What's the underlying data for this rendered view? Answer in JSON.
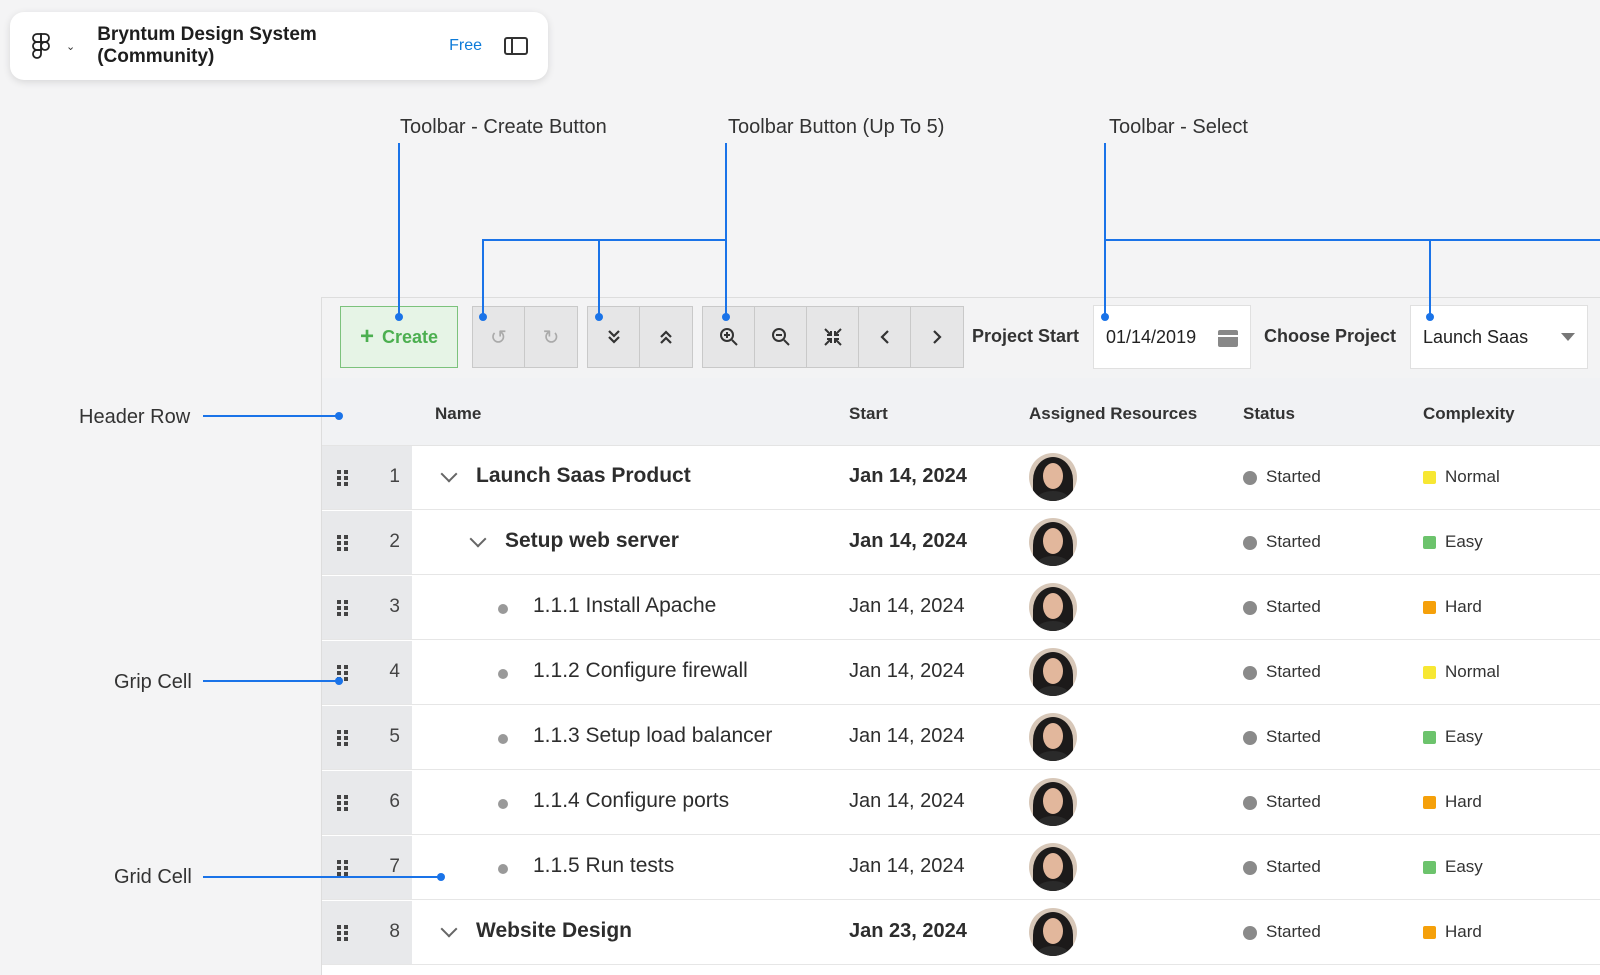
{
  "figma": {
    "title": "Bryntum Design System (Community)",
    "badge": "Free"
  },
  "annotations": {
    "create_button": "Toolbar - Create Button",
    "toolbar_button": "Toolbar Button (Up To 5)",
    "toolbar_select": "Toolbar - Select",
    "header_row": "Header Row",
    "grip_cell": "Grip Cell",
    "grid_cell": "Grid Cell"
  },
  "toolbar": {
    "create_label": "Create",
    "project_start_label": "Project Start",
    "project_start_value": "01/14/2019",
    "choose_project_label": "Choose Project",
    "choose_project_value": "Launch Saas",
    "buttons": [
      {
        "icon": "undo-icon",
        "glyph": "↺"
      },
      {
        "icon": "redo-icon",
        "glyph": "↻"
      },
      {
        "icon": "expand-all-icon",
        "glyph": "⌄"
      },
      {
        "icon": "collapse-all-icon",
        "glyph": "⌃"
      },
      {
        "icon": "zoom-in-icon",
        "glyph": "⊕"
      },
      {
        "icon": "zoom-out-icon",
        "glyph": "⊖"
      },
      {
        "icon": "zoom-to-fit-icon",
        "glyph": "⤧"
      },
      {
        "icon": "previous-icon",
        "glyph": "‹"
      },
      {
        "icon": "next-icon",
        "glyph": "›"
      }
    ]
  },
  "columns": [
    "Name",
    "Start",
    "Assigned Resources",
    "Status",
    "Complexity"
  ],
  "colors": {
    "accent": "#1a73e8",
    "create_green": "#4caf50",
    "normal": "#f7e733",
    "easy": "#6cc36c",
    "hard": "#f5a00a",
    "status": "#8a8a8a"
  },
  "rows": [
    {
      "num": "1",
      "name": "Launch Saas Product",
      "start": "Jan 14, 2024",
      "status": "Started",
      "complexity": "Normal",
      "level": 0,
      "parent": true
    },
    {
      "num": "2",
      "name": "Setup web server",
      "start": "Jan 14, 2024",
      "status": "Started",
      "complexity": "Easy",
      "level": 1,
      "parent": true
    },
    {
      "num": "3",
      "name": "1.1.1 Install Apache",
      "start": "Jan 14, 2024",
      "status": "Started",
      "complexity": "Hard",
      "level": 2,
      "parent": false
    },
    {
      "num": "4",
      "name": "1.1.2 Configure firewall",
      "start": "Jan 14, 2024",
      "status": "Started",
      "complexity": "Normal",
      "level": 2,
      "parent": false
    },
    {
      "num": "5",
      "name": "1.1.3 Setup load balancer",
      "start": "Jan 14, 2024",
      "status": "Started",
      "complexity": "Easy",
      "level": 2,
      "parent": false
    },
    {
      "num": "6",
      "name": "1.1.4 Configure ports",
      "start": "Jan 14, 2024",
      "status": "Started",
      "complexity": "Hard",
      "level": 2,
      "parent": false
    },
    {
      "num": "7",
      "name": "1.1.5 Run tests",
      "start": "Jan 14, 2024",
      "status": "Started",
      "complexity": "Easy",
      "level": 2,
      "parent": false
    },
    {
      "num": "8",
      "name": "Website Design",
      "start": "Jan 23, 2024",
      "status": "Started",
      "complexity": "Hard",
      "level": 0,
      "parent": true
    }
  ]
}
